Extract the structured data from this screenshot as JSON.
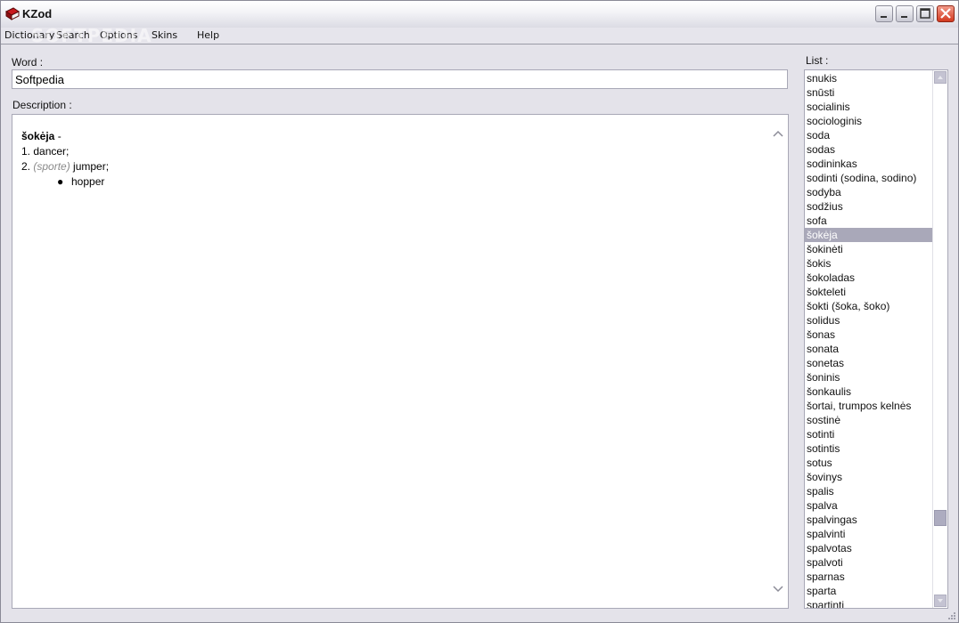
{
  "window": {
    "title": "KZod",
    "icon": "red-book-icon",
    "controls": [
      "minimize-icon",
      "restore-icon",
      "maximize-icon",
      "close-icon"
    ]
  },
  "menu": {
    "items": [
      "Dictionary",
      "Search",
      "Options",
      "Skins",
      "Help"
    ]
  },
  "watermark": "SOFTPEDIA",
  "word": {
    "label": "Word :",
    "value": "Softpedia"
  },
  "description": {
    "label": "Description :",
    "headword": "šokėja",
    "dash": " -",
    "sense1": "1. dancer;",
    "sense2_num": "2.",
    "sense2_domain": "(sporte)",
    "sense2_text": "jumper;",
    "bullet": "hopper"
  },
  "list": {
    "label": "List :",
    "items": [
      "snukis",
      "snūsti",
      "socialinis",
      "sociologinis",
      "soda",
      "sodas",
      "sodininkas",
      "sodinti (sodina, sodino)",
      "sodyba",
      "sodžius",
      "sofa",
      "šokėja",
      "šokinėti",
      "šokis",
      "šokoladas",
      "šokteleti",
      "šokti (šoka, šoko)",
      "solidus",
      "šonas",
      "sonata",
      "sonetas",
      "šoninis",
      "šonkaulis",
      "šortai, trumpos kelnės",
      "sostinė",
      "sotinti",
      "sotintis",
      "sotus",
      "šovinys",
      "spalis",
      "spalva",
      "spalvingas",
      "spalvinti",
      "spalvotas",
      "spalvoti",
      "sparnas",
      "sparta",
      "spartinti"
    ],
    "selected": "šokėja"
  },
  "colors": {
    "selection": "#a9a8b9",
    "window_bg": "#e4e3ea",
    "close_button": "#d3391f"
  }
}
